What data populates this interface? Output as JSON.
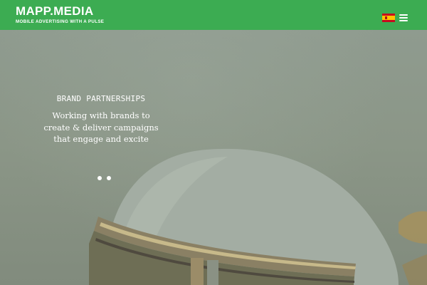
{
  "header": {
    "logo_text": "MAPP.MEDIA",
    "tagline": "MOBILE ADVERTISING WITH A PULSE",
    "background_color": "#3cac52",
    "language_flag_icon": "spain-flag-icon",
    "menu_icon": "hamburger-menu-icon"
  },
  "slide": {
    "title": "BRAND PARTNERSHIPS",
    "caption": "Working with brands to\ncreate & deliver campaigns\nthat engage and excite",
    "dot_count": 2,
    "active_dot_index": 0
  }
}
